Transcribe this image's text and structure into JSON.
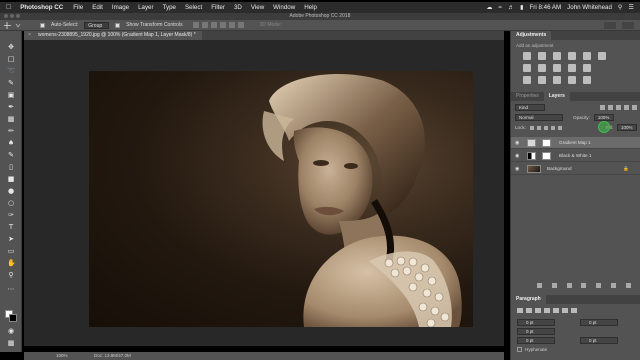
{
  "menubar": {
    "apple": "",
    "app": "Photoshop CC",
    "items": [
      "File",
      "Edit",
      "Image",
      "Layer",
      "Type",
      "Select",
      "Filter",
      "3D",
      "View",
      "Window",
      "Help"
    ],
    "time": "Fri 8:46 AM",
    "user": "John Whitehead"
  },
  "titlebar": {
    "title": "Adobe Photoshop CC 2018"
  },
  "options": {
    "auto_select": "Auto-Select:",
    "group": "Group",
    "show_transform": "Show Transform Controls",
    "mode3d": "3D Mode:"
  },
  "doc": {
    "tab_title": "womens-2308895_1920.jpg @ 100% (Gradient Map 1, Layer Mask/8) *",
    "zoom": "100%",
    "docsize": "Doc: 13.8M/47.0M"
  },
  "adjustments": {
    "tab": "Adjustments",
    "subtitle": "Add an adjustment"
  },
  "layers_panel": {
    "tabs": [
      "Properties",
      "Layers"
    ],
    "kind": "Kind",
    "blend_mode": "Normal",
    "opacity_label": "Opacity:",
    "opacity_value": "100%",
    "lock_label": "Lock:",
    "fill_label": "Fill:",
    "fill_value": "100%",
    "layers": [
      {
        "name": "Gradient Map 1",
        "selected": true
      },
      {
        "name": "Black & White 1",
        "selected": false
      },
      {
        "name": "Background",
        "selected": false
      }
    ],
    "bottom_icons": [
      "link-icon",
      "fx-icon",
      "mask-icon",
      "adjustment-icon",
      "folder-icon",
      "new-layer-icon",
      "trash-icon"
    ]
  },
  "paragraph": {
    "tab": "Paragraph",
    "fields": [
      "0 pt",
      "0 pt",
      "0 pt",
      "0 pt",
      "0 pt"
    ],
    "hyphenate": "Hyphenate"
  },
  "colors": {
    "panel": "#535353",
    "dark": "#424242",
    "canvas_bg": "#282828",
    "menubar": "#2b2b2b",
    "cursor_highlight": "#3cbf4a"
  }
}
